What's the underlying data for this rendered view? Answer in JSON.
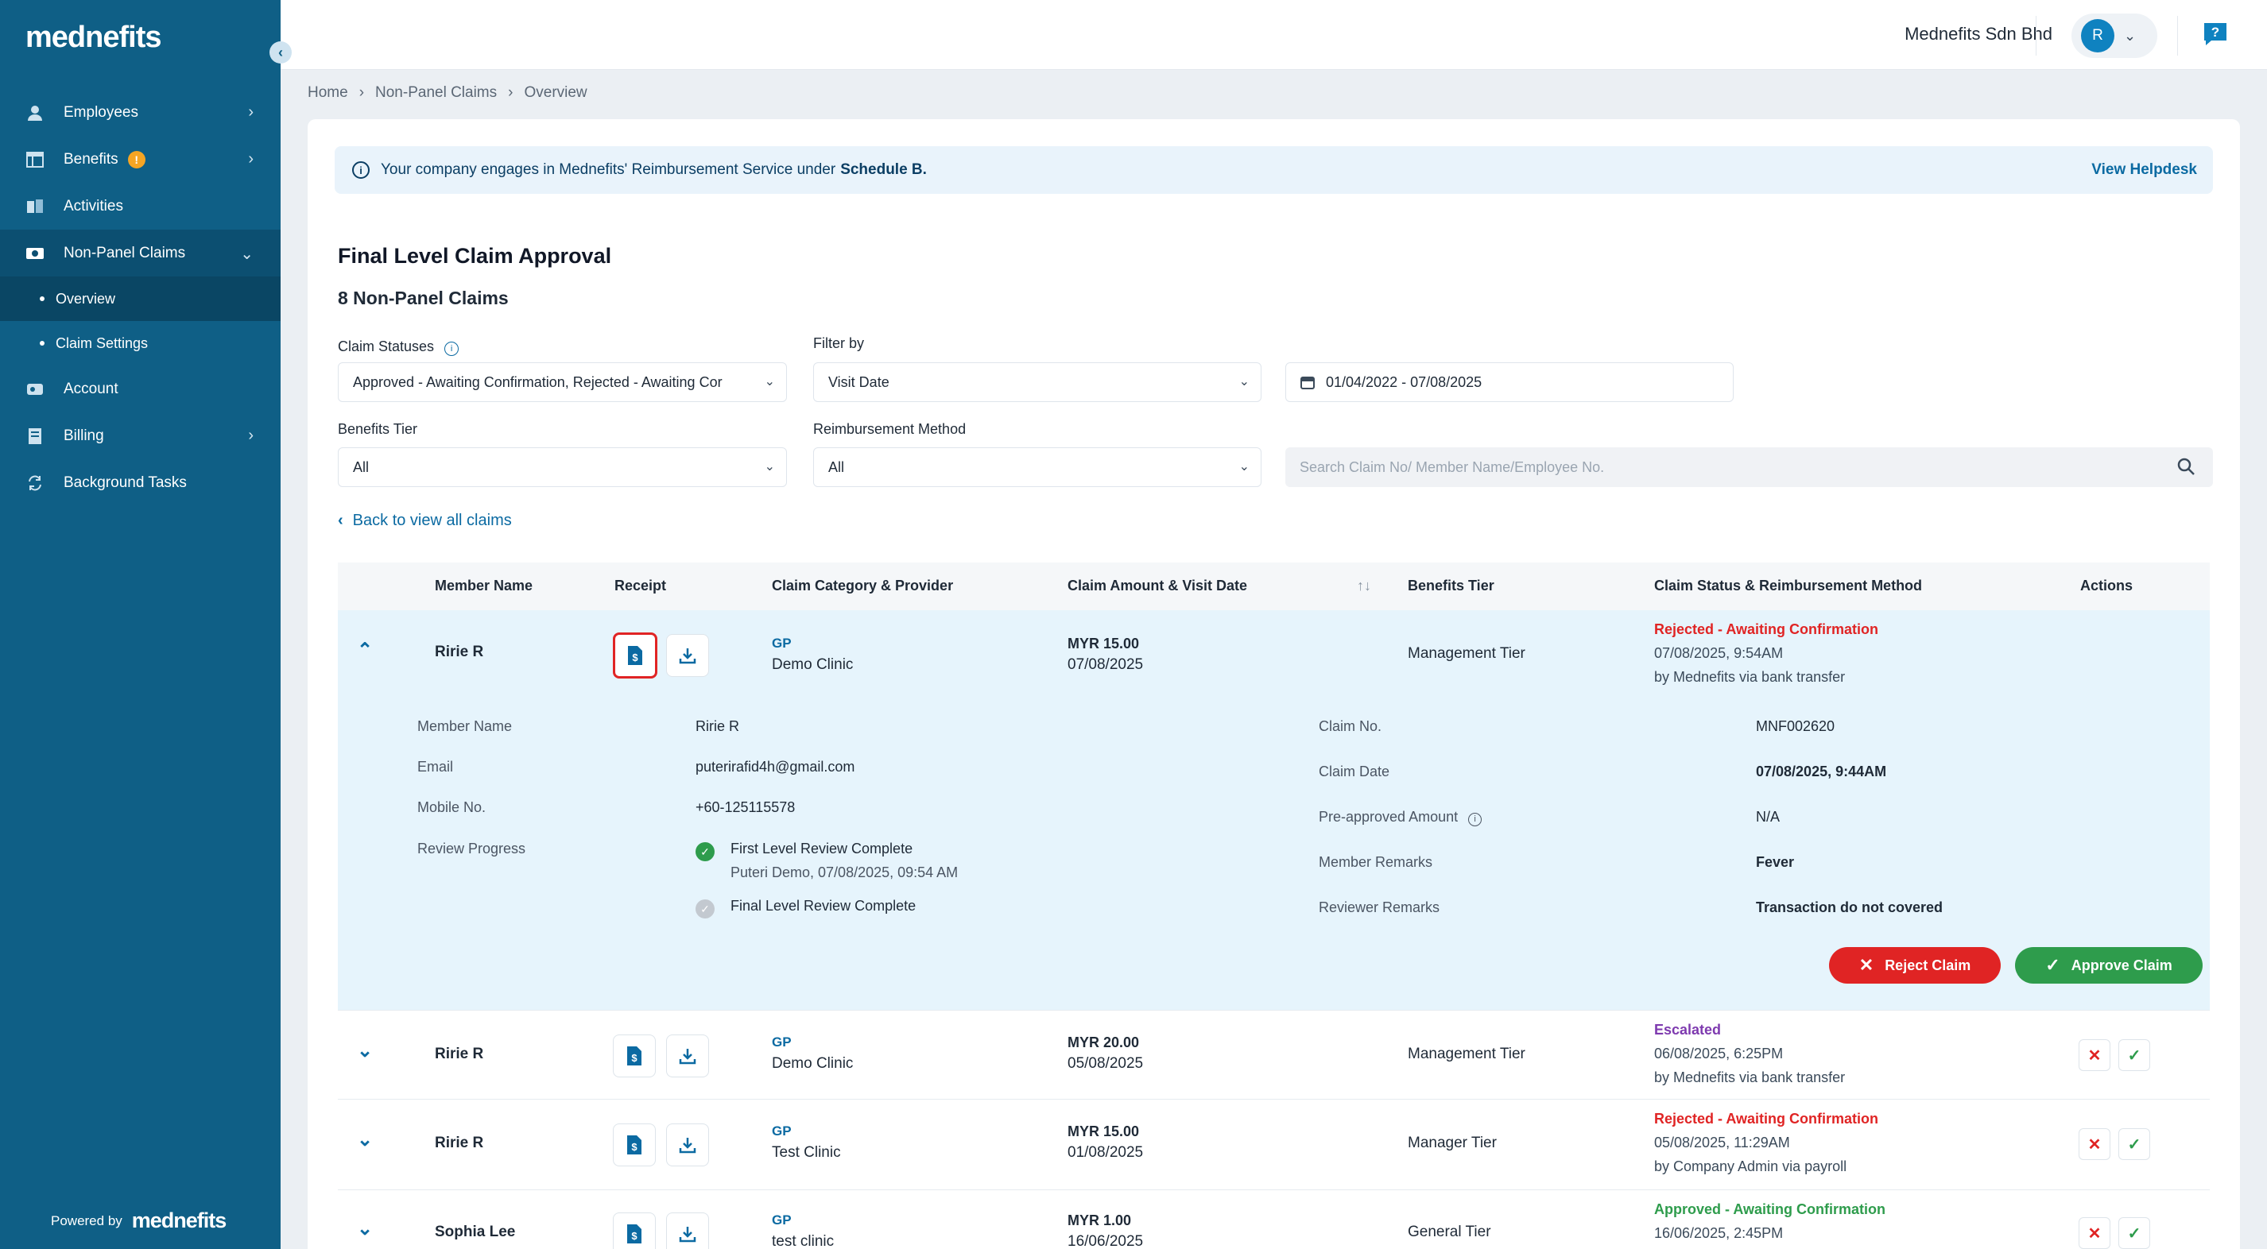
{
  "sidebar": {
    "logo": "mednefits",
    "items": [
      {
        "label": "Employees"
      },
      {
        "label": "Benefits",
        "badge": "!"
      },
      {
        "label": "Activities"
      },
      {
        "label": "Non-Panel Claims"
      },
      {
        "label": "Account"
      },
      {
        "label": "Billing"
      },
      {
        "label": "Background Tasks"
      }
    ],
    "subitems": [
      {
        "label": "Overview"
      },
      {
        "label": "Claim Settings"
      }
    ],
    "powered_by": "Powered by",
    "powered_logo": "mednefits"
  },
  "header": {
    "company": "Mednefits Sdn Bhd",
    "avatar_initial": "R"
  },
  "breadcrumb": [
    "Home",
    "Non-Panel Claims",
    "Overview"
  ],
  "banner": {
    "text": "Your company engages in Mednefits' Reimbursement Service under",
    "bold": "Schedule B.",
    "link": "View Helpdesk"
  },
  "page": {
    "title": "Final Level Claim Approval",
    "count": "8 Non-Panel Claims"
  },
  "filters": {
    "claim_statuses_label": "Claim Statuses",
    "claim_statuses_value": "Approved - Awaiting Confirmation, Rejected - Awaiting Cor",
    "filter_by_label": "Filter by",
    "filter_by_value": "Visit Date",
    "date_range": "01/04/2022 - 07/08/2025",
    "benefits_tier_label": "Benefits Tier",
    "benefits_tier_value": "All",
    "reimbursement_label": "Reimbursement Method",
    "reimbursement_value": "All",
    "search_placeholder": "Search Claim No/ Member Name/Employee No."
  },
  "back_link": "Back to view all claims",
  "table": {
    "headers": {
      "member": "Member Name",
      "receipt": "Receipt",
      "category": "Claim Category & Provider",
      "amount": "Claim Amount & Visit Date",
      "tier": "Benefits Tier",
      "status": "Claim Status & Reimbursement Method",
      "actions": "Actions"
    },
    "rows": [
      {
        "member": "Ririe R",
        "category": "GP",
        "provider": "Demo Clinic",
        "amount": "MYR 15.00",
        "date": "07/08/2025",
        "tier": "Management Tier",
        "status": "Rejected - Awaiting Confirmation",
        "status_date": "07/08/2025, 9:54AM",
        "method": "by Mednefits via bank transfer"
      },
      {
        "member": "Ririe R",
        "category": "GP",
        "provider": "Demo Clinic",
        "amount": "MYR 20.00",
        "date": "05/08/2025",
        "tier": "Management Tier",
        "status": "Escalated",
        "status_date": "06/08/2025, 6:25PM",
        "method": "by Mednefits via bank transfer"
      },
      {
        "member": "Ririe R",
        "category": "GP",
        "provider": "Test Clinic",
        "amount": "MYR 15.00",
        "date": "01/08/2025",
        "tier": "Manager Tier",
        "status": "Rejected - Awaiting Confirmation",
        "status_date": "05/08/2025, 11:29AM",
        "method": "by Company Admin via payroll"
      },
      {
        "member": "Sophia Lee",
        "category": "GP",
        "provider": "test clinic",
        "amount": "MYR 1.00",
        "date": "16/06/2025",
        "tier": "General Tier",
        "status": "Approved - Awaiting Confirmation",
        "status_date": "16/06/2025, 2:45PM",
        "method": ""
      }
    ]
  },
  "detail": {
    "member_name_label": "Member Name",
    "member_name": "Ririe R",
    "email_label": "Email",
    "email": "puterirafid4h@gmail.com",
    "mobile_label": "Mobile No.",
    "mobile": "+60-125115578",
    "review_label": "Review Progress",
    "review_1": "First Level Review Complete",
    "review_1_sub": "Puteri Demo, 07/08/2025, 09:54 AM",
    "review_2": "Final Level Review Complete",
    "claim_no_label": "Claim No.",
    "claim_no": "MNF002620",
    "claim_date_label": "Claim Date",
    "claim_date": "07/08/2025, 9:44AM",
    "preapproved_label": "Pre-approved Amount",
    "preapproved": "N/A",
    "member_remarks_label": "Member Remarks",
    "member_remarks": "Fever",
    "reviewer_remarks_label": "Reviewer Remarks",
    "reviewer_remarks": "Transaction do not covered",
    "reject_label": "Reject Claim",
    "approve_label": "Approve Claim"
  },
  "colors": {
    "sidebar": "#0f5f86",
    "accent": "#0b6aa2",
    "reject": "#e02424",
    "approve": "#2e9c4c",
    "escalated": "#7e3aaf",
    "expanded_row": "#e6f4fc"
  }
}
